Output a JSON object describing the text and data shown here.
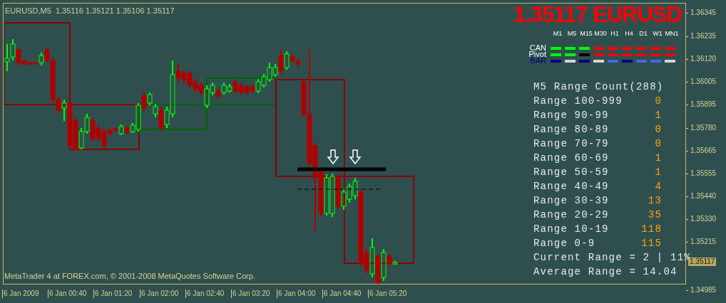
{
  "symbol_bar": {
    "symbol": "EURUSD,M5",
    "open": "1.35116",
    "high": "1.35121",
    "low": "1.35106",
    "close": "1.35117"
  },
  "headline": "1.35117 EURUSD",
  "timeframes": [
    "M1",
    "M5",
    "M15",
    "M30",
    "H1",
    "H4",
    "D1",
    "W1",
    "MN1"
  ],
  "signal_rows": [
    {
      "label": "CAN",
      "color": "#ffffff",
      "cells": [
        {
          "color": "#00ff00"
        },
        {
          "color": "#00ff00"
        },
        {
          "color": "#00ff00"
        },
        {
          "color": "#ff0000"
        },
        {
          "color": "#ff0000"
        },
        {
          "color": "#ff0000"
        },
        {
          "color": "#ff0000"
        },
        {
          "color": "#ff0000"
        },
        {
          "color": "#ff0000"
        }
      ]
    },
    {
      "label": "Pivot",
      "color": "#ffffff",
      "cells": [
        {
          "color": "#00ff00"
        },
        {
          "color": "#00ff00"
        },
        {
          "color": "#000000"
        },
        {
          "color": "#ff0000"
        },
        {
          "color": "#ff0000"
        },
        {
          "color": "#ff0000"
        },
        {
          "color": "#ff0000"
        },
        {
          "color": "#ff0000"
        },
        {
          "color": "#ff0000"
        }
      ]
    },
    {
      "label": "BAR",
      "color": "#000080",
      "cells": [
        {
          "color": "#000080"
        },
        {
          "color": "#d3d3d3"
        },
        {
          "color": "#000080"
        },
        {
          "color": "#d3d3d3"
        },
        {
          "color": "#4169e1"
        },
        {
          "color": "#000080"
        },
        {
          "color": "#4169e1"
        },
        {
          "color": "#4169e1"
        },
        {
          "color": "#d3d3d3"
        }
      ]
    }
  ],
  "range_stats": {
    "title": "M5 Range Count(288)",
    "rows": [
      {
        "label": "Range 100-999",
        "count": "0"
      },
      {
        "label": "Range 90-99",
        "count": "1"
      },
      {
        "label": "Range 80-89",
        "count": "0"
      },
      {
        "label": "Range 70-79",
        "count": "0"
      },
      {
        "label": "Range 60-69",
        "count": "1"
      },
      {
        "label": "Range 50-59",
        "count": "1"
      },
      {
        "label": "Range 40-49",
        "count": "4"
      },
      {
        "label": "Range 30-39",
        "count": "13"
      },
      {
        "label": "Range 20-29",
        "count": "35"
      },
      {
        "label": "Range 10-19",
        "count": "118"
      },
      {
        "label": "Range 0-9",
        "count": "115"
      }
    ],
    "current": "Current Range = 2 | 11%",
    "average": "Average Range = 14.04"
  },
  "copyright": "MetaTrader 4 at FOREX.com, © 2001-2008 MetaQuotes Software Corp.",
  "price_axis": [
    "1.36345",
    "1.36235",
    "1.36120",
    "1.36005",
    "1.35895",
    "1.35780",
    "1.35665",
    "1.35555",
    "1.35440",
    "1.35330",
    "1.35215",
    "1.34985"
  ],
  "current_price": "1.35117",
  "time_axis": [
    "6 Jan 2009",
    "6 Jan 00:40",
    "6 Jan 01:20",
    "6 Jan 02:00",
    "6 Jan 02:40",
    "6 Jan 03:20",
    "6 Jan 04:00",
    "6 Jan 04:40",
    "6 Jan 05:20"
  ]
}
